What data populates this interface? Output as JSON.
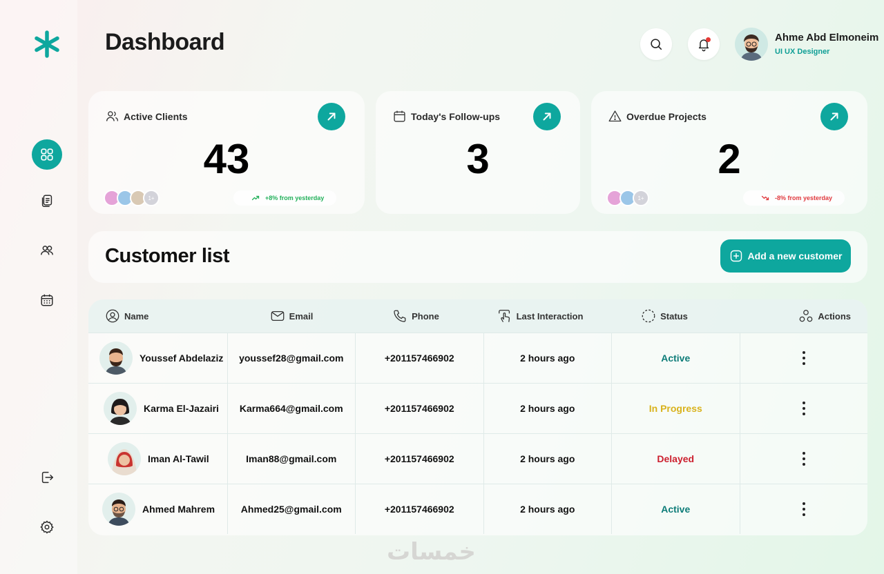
{
  "header": {
    "title": "Dashboard",
    "user_name": "Ahme Abd Elmoneim",
    "user_role": "UI UX Designer"
  },
  "colors": {
    "accent": "#0ea79e",
    "status_active": "#0d7c78",
    "status_in_progress": "#d9b21c",
    "status_delayed": "#cc1f2e",
    "trend_up": "#22b05a",
    "trend_down": "#e0393e"
  },
  "sidebar": {
    "items": [
      {
        "icon": "grid-icon",
        "active": true
      },
      {
        "icon": "documents-icon",
        "active": false
      },
      {
        "icon": "users-icon",
        "active": false
      },
      {
        "icon": "calendar-icon",
        "active": false
      },
      {
        "icon": "logout-icon",
        "active": false
      },
      {
        "icon": "settings-icon",
        "active": false
      }
    ]
  },
  "cards": [
    {
      "title": "Active Clients",
      "value": "43",
      "more": "1+",
      "trend": "+8% from yesterday",
      "trend_dir": "up"
    },
    {
      "title": "Today's Follow-ups",
      "value": "3"
    },
    {
      "title": "Overdue Projects",
      "value": "2",
      "more": "1+",
      "trend": "-8% from yesterday",
      "trend_dir": "down"
    }
  ],
  "customer_list": {
    "title": "Customer list",
    "add_label": "Add a new customer"
  },
  "table": {
    "columns": [
      "Name",
      "Email",
      "Phone",
      "Last Interaction",
      "Status",
      "Actions"
    ],
    "rows": [
      {
        "name": "Youssef Abdelaziz",
        "email": "youssef28@gmail.com",
        "phone": "+201157466902",
        "last": "2 hours ago",
        "status": "Active"
      },
      {
        "name": "Karma El-Jazairi",
        "email": "Karma664@gmail.com",
        "phone": "+201157466902",
        "last": "2 hours ago",
        "status": "In Progress"
      },
      {
        "name": "Iman Al-Tawil",
        "email": "Iman88@gmail.com",
        "phone": "+201157466902",
        "last": "2 hours ago",
        "status": "Delayed"
      },
      {
        "name": "Ahmed Mahrem",
        "email": "Ahmed25@gmail.com",
        "phone": "+201157466902",
        "last": "2 hours ago",
        "status": "Active"
      }
    ]
  },
  "watermark": "خمسات"
}
